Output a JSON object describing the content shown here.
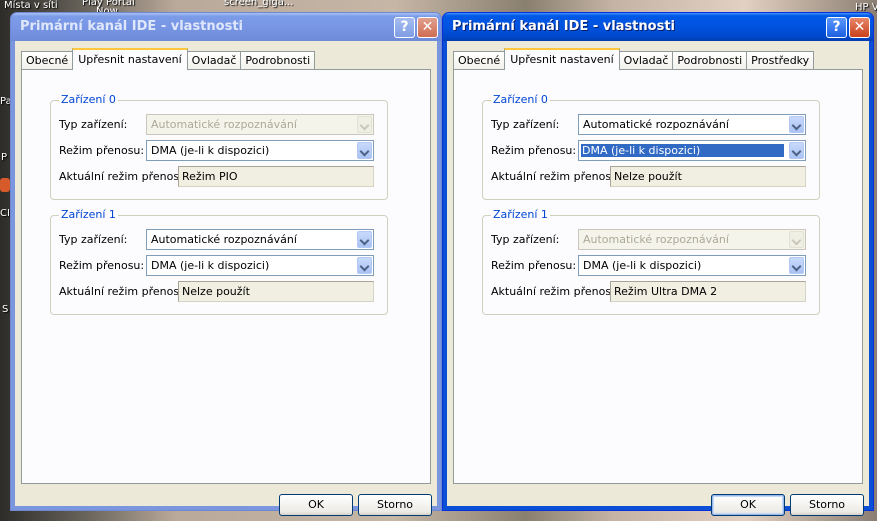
{
  "desktop": {
    "labels": [
      "Místa v síti",
      "Play Portal",
      "Now",
      "screen_giga...",
      "HP V",
      "Pa",
      "P",
      "CI",
      "S"
    ]
  },
  "windows": [
    {
      "title": "Primární kanál IDE - vlastnosti",
      "state": "inactive",
      "tabs": [
        "Obecné",
        "Upřesnit nastavení",
        "Ovladač",
        "Podrobnosti"
      ],
      "selected_tab": "Upřesnit nastavení",
      "groups": [
        {
          "title": "Zařízení 0",
          "device_type_label": "Typ zařízení:",
          "device_type_value": "Automatické rozpoznávání",
          "device_type_disabled": true,
          "transfer_mode_label": "Režim přenosu:",
          "transfer_mode_value": "DMA (je-li k dispozici)",
          "current_mode_label": "Aktuální režim přenosu:",
          "current_mode_value": "Režim PIO"
        },
        {
          "title": "Zařízení 1",
          "device_type_label": "Typ zařízení:",
          "device_type_value": "Automatické rozpoznávání",
          "device_type_disabled": false,
          "transfer_mode_label": "Režim přenosu:",
          "transfer_mode_value": "DMA (je-li k dispozici)",
          "current_mode_label": "Aktuální režim přenosu:",
          "current_mode_value": "Nelze použít"
        }
      ],
      "ok_label": "OK",
      "cancel_label": "Storno"
    },
    {
      "title": "Primární kanál IDE - vlastnosti",
      "state": "active",
      "tabs": [
        "Obecné",
        "Upřesnit nastavení",
        "Ovladač",
        "Podrobnosti",
        "Prostředky"
      ],
      "selected_tab": "Upřesnit nastavení",
      "groups": [
        {
          "title": "Zařízení 0",
          "device_type_label": "Typ zařízení:",
          "device_type_value": "Automatické rozpoznávání",
          "device_type_disabled": false,
          "transfer_mode_label": "Režim přenosu:",
          "transfer_mode_value": "DMA (je-li k dispozici)",
          "transfer_mode_focused": true,
          "current_mode_label": "Aktuální režim přenosu:",
          "current_mode_value": "Nelze použít"
        },
        {
          "title": "Zařízení 1",
          "device_type_label": "Typ zařízení:",
          "device_type_value": "Automatické rozpoznávání",
          "device_type_disabled": true,
          "transfer_mode_label": "Režim přenosu:",
          "transfer_mode_value": "DMA (je-li k dispozici)",
          "current_mode_label": "Aktuální režim přenosu:",
          "current_mode_value": "Režim Ultra DMA 2"
        }
      ],
      "ok_label": "OK",
      "cancel_label": "Storno"
    }
  ],
  "colors": {
    "titlebar_active": "#0058e6",
    "titlebar_inactive": "#7b9be8",
    "group_title": "#0046d5",
    "tab_highlight": "#ffc83c",
    "selection": "#316ac5"
  },
  "icons": [
    "help-icon",
    "close-icon",
    "chevron-down-icon"
  ]
}
